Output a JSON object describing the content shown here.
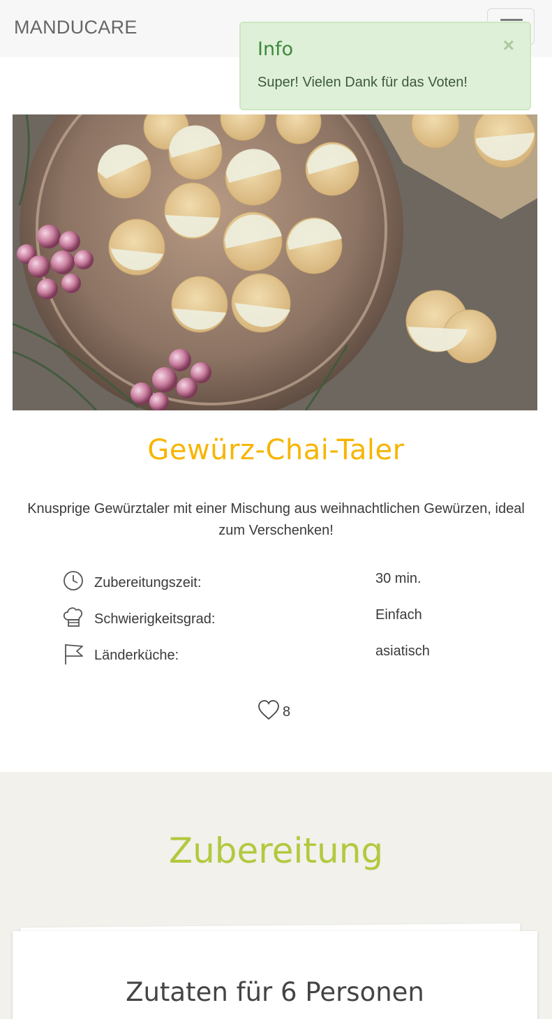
{
  "navbar": {
    "brand": "MANDUCARE",
    "menu_icon": "hamburger-icon"
  },
  "alert": {
    "title": "Info",
    "message": "Super! Vielen Dank für das Voten!",
    "close": "×"
  },
  "recipe": {
    "title": "Gewürz-Chai-Taler",
    "description": "Knusprige Gewürztaler mit einer Mischung aus weihnachtlichen Gewürzen, ideal zum Verschenken!",
    "info": [
      {
        "icon": "clock-icon",
        "label": "Zubereitungszeit:",
        "value": "30 min."
      },
      {
        "icon": "chef-hat-icon",
        "label": "Schwierigkeitsgrad:",
        "value": "Einfach"
      },
      {
        "icon": "flag-icon",
        "label": "Länderküche:",
        "value": "asiatisch"
      }
    ],
    "likes": "8"
  },
  "preparation": {
    "title": "Zubereitung",
    "ingredients_title": "Zutaten für 6 Personen"
  },
  "colors": {
    "title": "#f7b500",
    "section_title": "#b2c93e",
    "alert_bg": "#dff0d8",
    "section_bg": "#f2f1ec"
  }
}
